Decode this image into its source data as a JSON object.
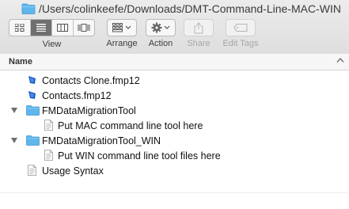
{
  "window": {
    "path_title": "/Users/colinkeefe/Downloads/DMT-Command-Line-MAC-WIN"
  },
  "toolbar": {
    "view_label": "View",
    "arrange_label": "Arrange",
    "action_label": "Action",
    "share_label": "Share",
    "edit_tags_label": "Edit Tags"
  },
  "list": {
    "column_name": "Name",
    "items": [
      {
        "label": "Contacts Clone.fmp12",
        "icon": "filemaker-file-icon",
        "expanded": false
      },
      {
        "label": "Contacts.fmp12",
        "icon": "filemaker-file-icon",
        "expanded": false
      },
      {
        "label": "FMDataMigrationTool",
        "icon": "folder-icon",
        "expanded": true
      },
      {
        "label": "Put MAC command line tool here",
        "icon": "text-document-icon",
        "expanded": false
      },
      {
        "label": "FMDataMigrationTool_WIN",
        "icon": "folder-icon",
        "expanded": true
      },
      {
        "label": "Put WIN command line tool files here",
        "icon": "text-document-icon",
        "expanded": false
      },
      {
        "label": "Usage Syntax",
        "icon": "text-document-icon",
        "expanded": false
      }
    ]
  },
  "colors": {
    "folder": "#5fb6ec",
    "filemaker_icon": "#1d5fc4",
    "active_segment": "#6f6f6f"
  }
}
